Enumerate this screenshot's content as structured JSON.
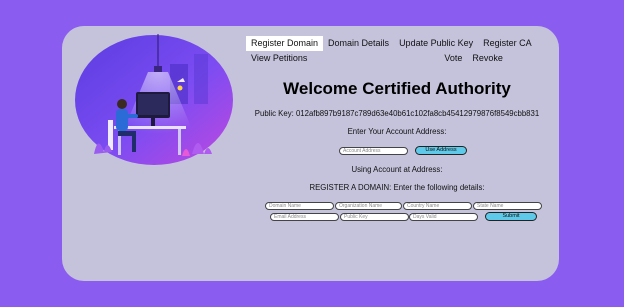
{
  "nav": {
    "items": [
      "Register Domain",
      "Domain Details",
      "Update Public Key",
      "Register CA",
      "View Petitions"
    ],
    "items_row2": [
      "Vote",
      "Revoke"
    ],
    "active_index": 0
  },
  "header": {
    "title": "Welcome Certified Authority"
  },
  "public_key": {
    "text": "Public Key: 012afb897b9187c789d63e40b61c102fa8cb45412979876f8549cbb831"
  },
  "account": {
    "prompt": "Enter Your Account Address:",
    "input_placeholder": "Account Address",
    "button_label": "Use Address",
    "status": "Using Account at Address:"
  },
  "register": {
    "heading": "REGISTER A DOMAIN: Enter the following details:",
    "fields": {
      "domain_name": "Domain Name",
      "organization_name": "Organization Name",
      "country_name": "Country Name",
      "state_name": "State Name",
      "email_address": "Email Address",
      "public_key": "Public Key",
      "days_valid": "Days Valid"
    },
    "submit_label": "Submit"
  },
  "colors": {
    "background": "#8a5cf0",
    "card": "#c5c3dc",
    "button": "#5ec9e8"
  }
}
